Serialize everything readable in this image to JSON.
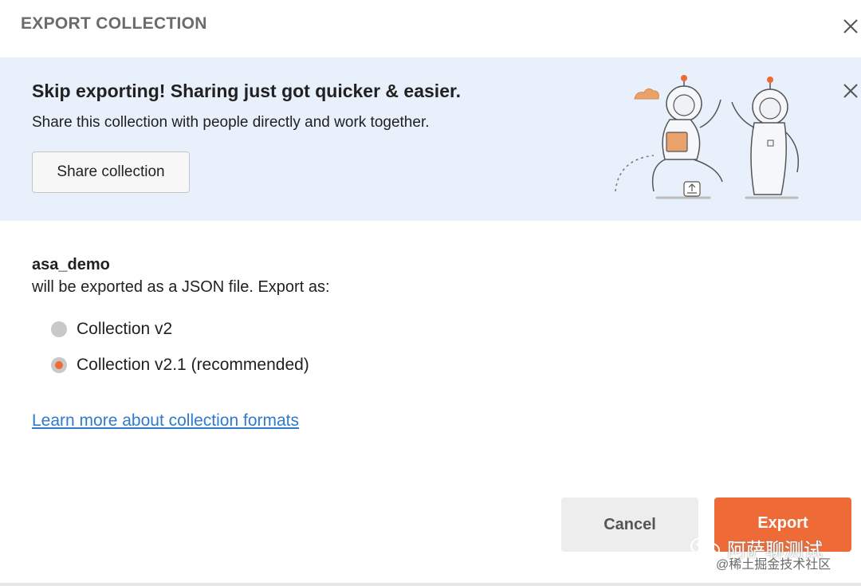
{
  "dialog": {
    "title": "EXPORT COLLECTION"
  },
  "banner": {
    "title": "Skip exporting! Sharing just got quicker & easier.",
    "text": "Share this collection with people directly and work together.",
    "share_button": "Share collection"
  },
  "export": {
    "collection_name": "asa_demo",
    "description": "will be exported as a JSON file. Export as:",
    "options": [
      {
        "label": "Collection v2",
        "selected": false
      },
      {
        "label": "Collection v2.1 (recommended)",
        "selected": true
      }
    ],
    "learn_more": "Learn more about collection formats"
  },
  "footer": {
    "cancel": "Cancel",
    "export": "Export"
  },
  "watermark": {
    "main": "阿萨聊测试",
    "sub": "@稀土掘金技术社区"
  },
  "colors": {
    "accent": "#ee6a36",
    "banner_bg": "#e8f0fc",
    "link": "#2f7ad1"
  },
  "icons": {
    "close": "close-icon",
    "banner_close": "close-icon",
    "illustration": "astronauts-illustration",
    "watermark": "wechat-icon"
  }
}
